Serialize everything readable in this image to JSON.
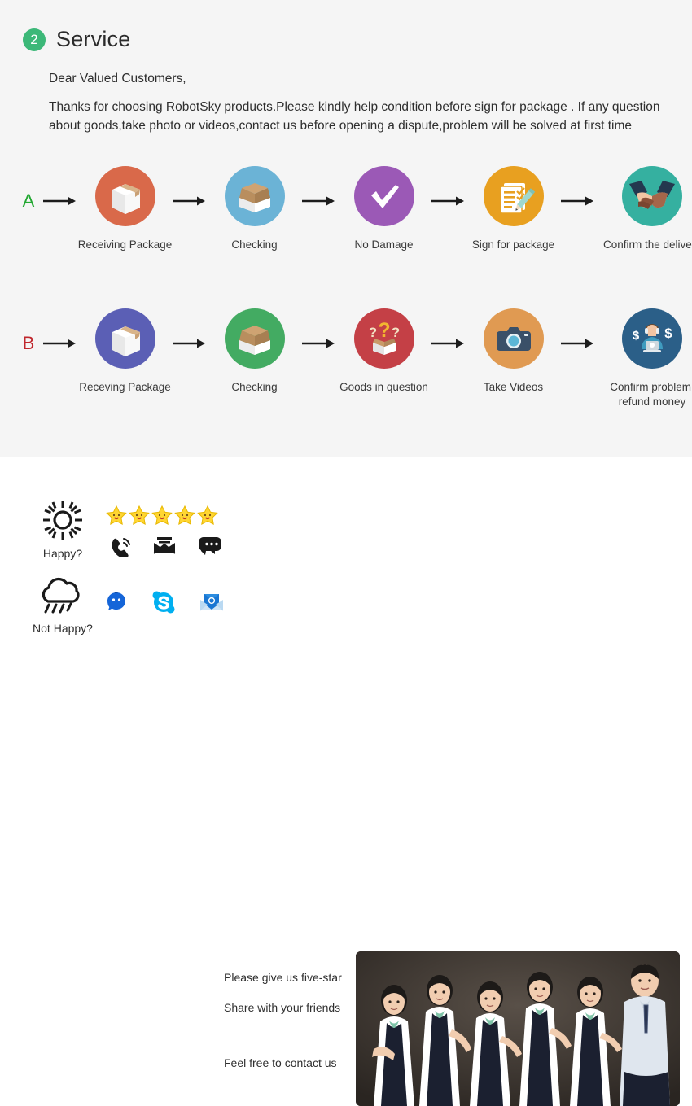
{
  "section": {
    "number": "2",
    "title": "Service",
    "badge_color": "#3cb878"
  },
  "intro": {
    "greeting": "Dear Valued Customers,",
    "body": "Thanks for choosing RobotSky products.Please kindly help condition before sign for package . If any question about goods,take photo or videos,contact us before opening a dispute,problem will be solved at first time"
  },
  "flows": [
    {
      "letter": "A",
      "letter_color": "#23a832",
      "steps": [
        {
          "label": "Receiving Package",
          "icon": "closed-box-icon",
          "circle_color": "#d9694a"
        },
        {
          "label": "Checking",
          "icon": "open-box-icon",
          "circle_color": "#6bb3d6"
        },
        {
          "label": "No Damage",
          "icon": "checkmark-icon",
          "circle_color": "#9b59b6"
        },
        {
          "label": "Sign for package",
          "icon": "clipboard-pencil-icon",
          "circle_color": "#e8a020"
        },
        {
          "label": "Confirm the delivery",
          "icon": "handshake-icon",
          "circle_color": "#35b0a0"
        }
      ]
    },
    {
      "letter": "B",
      "letter_color": "#c0272d",
      "steps": [
        {
          "label": "Receving Package",
          "icon": "closed-box-icon",
          "circle_color": "#5b5fb5"
        },
        {
          "label": "Checking",
          "icon": "open-box-icon",
          "circle_color": "#43ab62"
        },
        {
          "label": "Goods in question",
          "icon": "question-box-icon",
          "circle_color": "#c44046"
        },
        {
          "label": "Take Videos",
          "icon": "camera-icon",
          "circle_color": "#e09a52"
        },
        {
          "label": "Confirm problem, refund money",
          "icon": "support-agent-money-icon",
          "circle_color": "#2b5f88"
        }
      ]
    }
  ],
  "contact": {
    "happy": {
      "label": "Happy?",
      "icon": "sun-icon"
    },
    "not_happy": {
      "label": "Not Happy?",
      "icon": "rain-cloud-icon"
    },
    "stars": {
      "count": 5,
      "icon": "star-icon",
      "color": "#ffd633"
    },
    "happy_icons": [
      "phone-ring-icon",
      "envelope-icon",
      "speech-bubble-icon"
    ],
    "not_happy_icons": [
      "trade-manager-icon",
      "skype-icon",
      "mail-envelope-icon"
    ],
    "captions": {
      "five_star": "Please give us five-star",
      "share": "Share with your friends",
      "contact": "Feel free to contact us"
    }
  },
  "photo": {
    "name": "customer-service-team-photo",
    "people": 6
  }
}
